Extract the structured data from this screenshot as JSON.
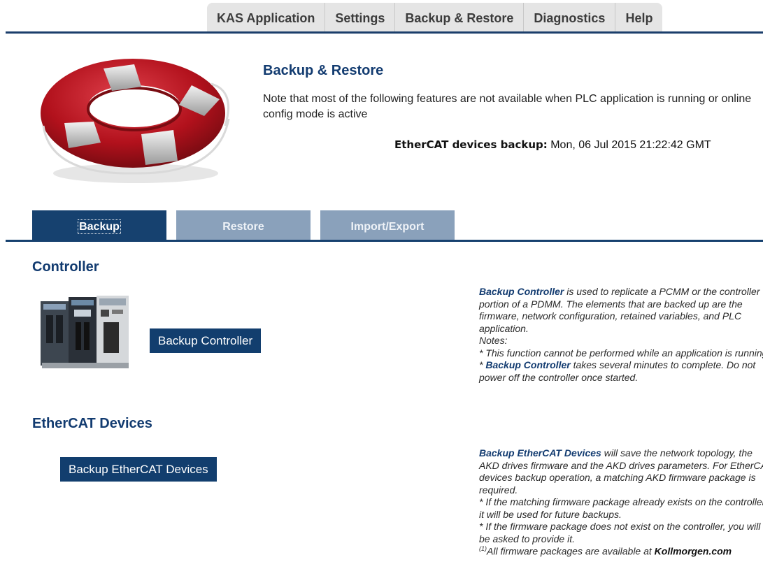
{
  "topnav": {
    "tabs": [
      {
        "label": "KAS Application"
      },
      {
        "label": "Settings"
      },
      {
        "label": "Backup & Restore"
      },
      {
        "label": "Diagnostics"
      },
      {
        "label": "Help"
      }
    ]
  },
  "header": {
    "title": "Backup & Restore",
    "note": "Note that most of the following features are not available when PLC application is running or online config mode is active",
    "ethercat_backup_label": "EtherCAT devices backup:",
    "ethercat_backup_value": "Mon, 06 Jul 2015 21:22:42 GMT"
  },
  "subtabs": [
    {
      "label": "Backup"
    },
    {
      "label": "Restore"
    },
    {
      "label": "Import/Export"
    }
  ],
  "controller": {
    "title": "Controller",
    "button": "Backup Controller",
    "help": {
      "p1_strong": "Backup Controller",
      "p1_rest": " is used to replicate a PCMM or the controller portion of a PDMM. The elements that are backed up are the firmware, network configuration, retained variables, and PLC application.",
      "notes_label": "Notes:",
      "note1": "* This function cannot be performed while an application is running.",
      "note2_prefix": "* ",
      "note2_strong": "Backup Controller",
      "note2_rest": " takes several minutes to complete. Do not power off the controller once started."
    }
  },
  "ethercat": {
    "title": "EtherCAT Devices",
    "button": "Backup EtherCAT Devices",
    "help": {
      "p1_strong": "Backup EtherCAT Devices",
      "p1_rest": " will save the network topology, the AKD drives firmware and the AKD drives parameters. For EtherCAT devices backup operation, a matching AKD firmware package is required.",
      "note1": "* If the matching firmware package already exists on the controller, it will be used for future backups.",
      "note2": "* If the firmware package does not exist on the controller, you will be asked to provide it."
    },
    "footnote_sup": "(1)",
    "footnote_text": "All firmware packages are available at ",
    "footnote_link": "Kollmorgen.com"
  },
  "colors": {
    "navy": "#123e6e",
    "tab_inactive": "#8aa1bb",
    "lifebuoy_red": "#b2111c"
  }
}
